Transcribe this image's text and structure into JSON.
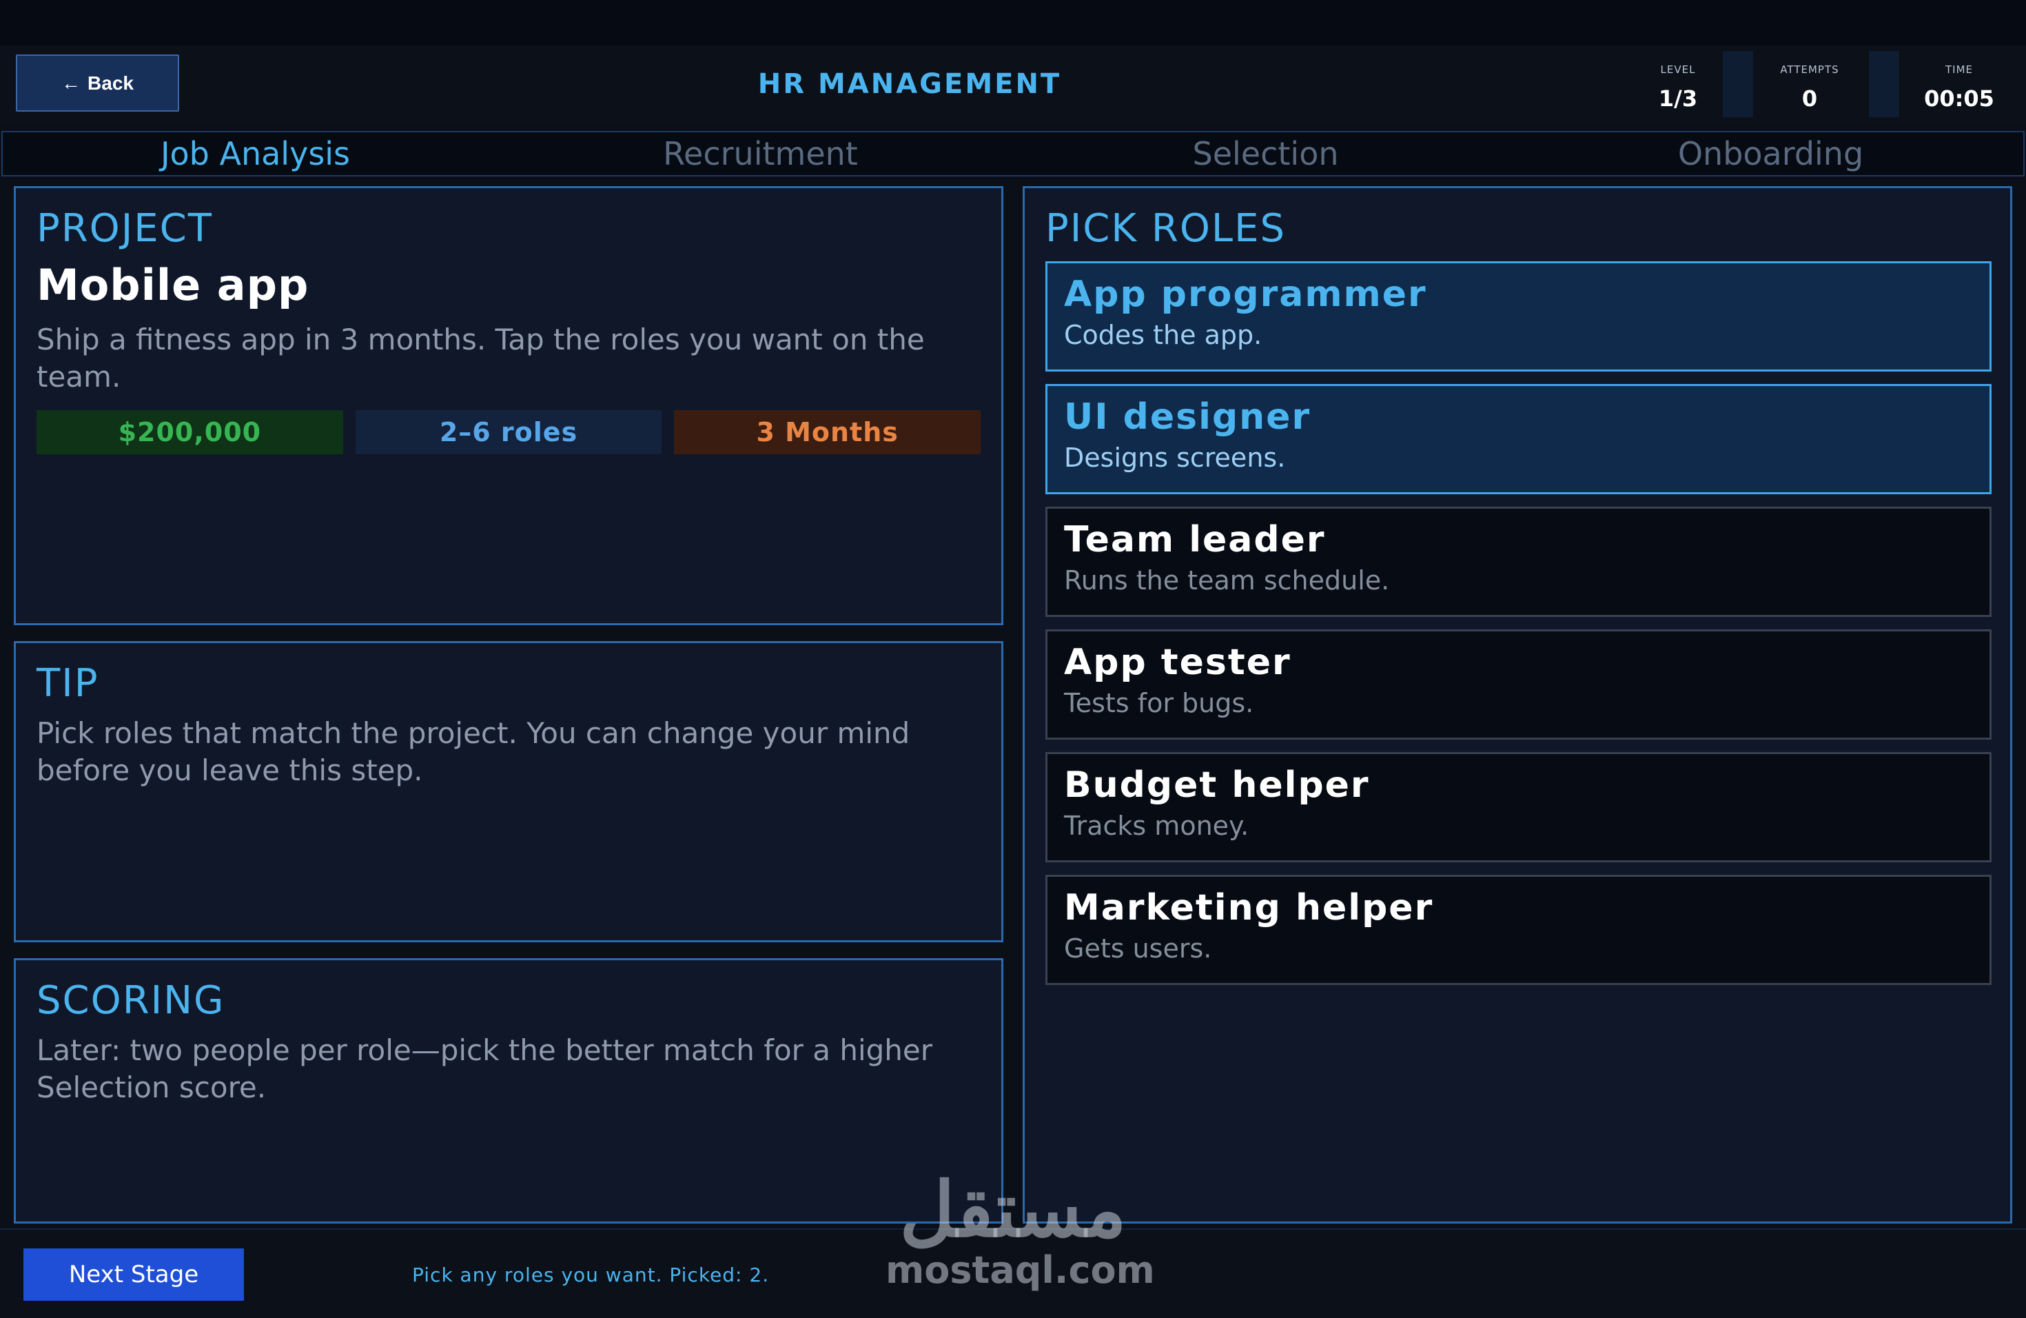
{
  "header": {
    "back_label": "Back",
    "title": "HR MANAGEMENT",
    "stats": {
      "level": {
        "label": "LEVEL",
        "value": "1/3"
      },
      "attempts": {
        "label": "ATTEMPTS",
        "value": "0"
      },
      "time": {
        "label": "TIME",
        "value": "00:05"
      }
    }
  },
  "tabs": [
    {
      "label": "Job Analysis",
      "active": true
    },
    {
      "label": "Recruitment",
      "active": false
    },
    {
      "label": "Selection",
      "active": false
    },
    {
      "label": "Onboarding",
      "active": false
    }
  ],
  "project": {
    "heading": "PROJECT",
    "name": "Mobile app",
    "description": "Ship a fitness app in 3 months. Tap the roles you want on the team.",
    "budget": "$200,000",
    "roles_range": "2–6 roles",
    "duration": "3 Months"
  },
  "tip": {
    "heading": "TIP",
    "text": "Pick roles that match the project. You can change your mind before you leave this step."
  },
  "scoring": {
    "heading": "SCORING",
    "text": "Later: two people per role—pick the better match for a higher Selection score."
  },
  "pick_roles": {
    "heading": "PICK ROLES",
    "roles": [
      {
        "title": "App programmer",
        "desc": "Codes the app.",
        "selected": true
      },
      {
        "title": "UI designer",
        "desc": "Designs screens.",
        "selected": true
      },
      {
        "title": "Team leader",
        "desc": "Runs the team schedule.",
        "selected": false
      },
      {
        "title": "App tester",
        "desc": "Tests for bugs.",
        "selected": false
      },
      {
        "title": "Budget helper",
        "desc": "Tracks money.",
        "selected": false
      },
      {
        "title": "Marketing helper",
        "desc": "Gets users.",
        "selected": false
      }
    ]
  },
  "footer": {
    "next_label": "Next Stage",
    "status": "Pick any roles you want. Picked: 2."
  },
  "watermark": {
    "arabic": "مستقل",
    "latin": "mostaql.com"
  },
  "colors": {
    "accent": "#4bb4ee",
    "panel_border": "#2a6aae",
    "budget": "#38b553",
    "duration": "#e88545",
    "next_button": "#1f4fd6"
  }
}
